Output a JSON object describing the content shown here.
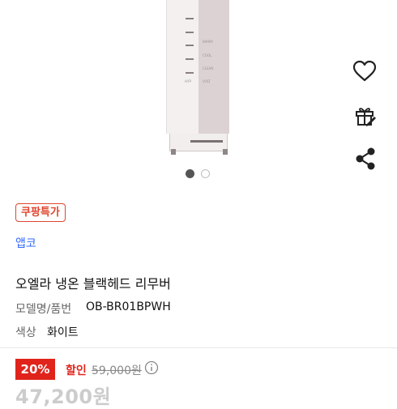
{
  "product": {
    "badge": "쿠팡특가",
    "brand": "앱코",
    "title": "오엘라 냉온 블랙헤드 리무버",
    "device_labels": [
      "WARM",
      "COOL",
      "CLEAN",
      "VOLT",
      "HYP"
    ]
  },
  "gallery": {
    "total_images": 2,
    "active_index": 0
  },
  "side_actions": [
    "heart-icon",
    "gift-icon",
    "share-icon"
  ],
  "specs": [
    {
      "label": "모델명/품번",
      "value": "OB-BR01BPWH"
    },
    {
      "label": "색상",
      "value": "화이트"
    }
  ],
  "price": {
    "discount_rate": "20%",
    "sale_label": "할인",
    "original": "59,000원",
    "final": "47,200원"
  },
  "colors": {
    "accent_red": "#e0241b",
    "brand_blue": "#346aff",
    "badge_border": "#e0452f"
  }
}
